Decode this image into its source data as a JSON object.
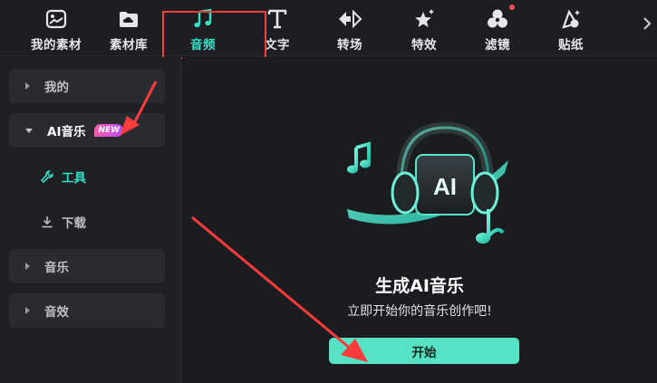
{
  "toolbar": {
    "tabs": [
      {
        "label": "我的素材",
        "icon": "image-icon"
      },
      {
        "label": "素材库",
        "icon": "cloud-folder-icon"
      },
      {
        "label": "音频",
        "icon": "music-note-icon",
        "active": true
      },
      {
        "label": "文字",
        "icon": "text-t-icon"
      },
      {
        "label": "转场",
        "icon": "transition-icon"
      },
      {
        "label": "特效",
        "icon": "sparkle-star-icon"
      },
      {
        "label": "滤镜",
        "icon": "filter-circles-icon",
        "notification": true
      },
      {
        "label": "贴纸",
        "icon": "sticker-icon"
      }
    ],
    "more_icon": "chevron-right-icon"
  },
  "sidebar": {
    "categories": [
      {
        "label": "我的",
        "expanded": false
      },
      {
        "label": "AI音乐",
        "expanded": true,
        "badge": "NEW"
      },
      {
        "label": "音乐",
        "expanded": false
      },
      {
        "label": "音效",
        "expanded": false
      }
    ],
    "ai_sub_items": [
      {
        "label": "工具",
        "icon": "wrench-icon",
        "selected": true
      },
      {
        "label": "下载",
        "icon": "download-icon",
        "selected": false
      }
    ]
  },
  "main": {
    "illustration": "ai-headphones-icon",
    "illustration_text": "AI",
    "title": "生成AI音乐",
    "subtitle": "立即开始你的音乐创作吧!",
    "start_button": "开始"
  },
  "colors": {
    "accent": "#35e0c8",
    "button": "#56e3c3",
    "highlight_box": "#ff3b3b",
    "annotation_arrow": "#ff3b3b",
    "badge_gradient": [
      "#ff5fa8",
      "#b24bff"
    ]
  }
}
